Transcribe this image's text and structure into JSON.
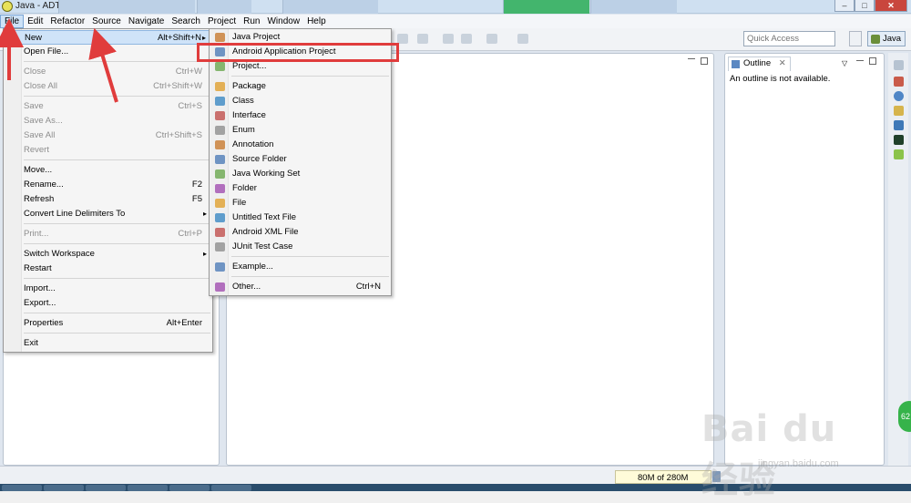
{
  "window": {
    "title": "Java - ADT",
    "controls": [
      "–",
      "□",
      "✕"
    ]
  },
  "menubar": [
    "File",
    "Edit",
    "Refactor",
    "Source",
    "Navigate",
    "Search",
    "Project",
    "Run",
    "Window",
    "Help"
  ],
  "toolbar": {
    "quick_access_placeholder": "Quick Access",
    "perspective_label": "Java"
  },
  "file_menu": [
    {
      "label": "New",
      "shortcut": "Alt+Shift+N",
      "submenu": true,
      "highlighted": true
    },
    {
      "label": "Open File...",
      "shortcut": ""
    },
    {
      "sep": true
    },
    {
      "label": "Close",
      "shortcut": "Ctrl+W",
      "disabled": true
    },
    {
      "label": "Close All",
      "shortcut": "Ctrl+Shift+W",
      "disabled": true
    },
    {
      "sep": true
    },
    {
      "label": "Save",
      "shortcut": "Ctrl+S",
      "disabled": true
    },
    {
      "label": "Save As...",
      "shortcut": "",
      "disabled": true
    },
    {
      "label": "Save All",
      "shortcut": "Ctrl+Shift+S",
      "disabled": true
    },
    {
      "label": "Revert",
      "shortcut": "",
      "disabled": true
    },
    {
      "sep": true
    },
    {
      "label": "Move...",
      "shortcut": ""
    },
    {
      "label": "Rename...",
      "shortcut": "F2"
    },
    {
      "label": "Refresh",
      "shortcut": "F5"
    },
    {
      "label": "Convert Line Delimiters To",
      "shortcut": "",
      "submenu": true
    },
    {
      "sep": true
    },
    {
      "label": "Print...",
      "shortcut": "Ctrl+P",
      "disabled": true
    },
    {
      "sep": true
    },
    {
      "label": "Switch Workspace",
      "shortcut": "",
      "submenu": true
    },
    {
      "label": "Restart",
      "shortcut": ""
    },
    {
      "sep": true
    },
    {
      "label": "Import...",
      "shortcut": ""
    },
    {
      "label": "Export...",
      "shortcut": ""
    },
    {
      "sep": true
    },
    {
      "label": "Properties",
      "shortcut": "Alt+Enter"
    },
    {
      "sep": true
    },
    {
      "label": "Exit",
      "shortcut": ""
    }
  ],
  "new_menu": [
    {
      "label": "Java Project",
      "shortcut": ""
    },
    {
      "label": "Android Application Project",
      "shortcut": "",
      "highlighted": true
    },
    {
      "label": "Project...",
      "shortcut": ""
    },
    {
      "sep": true
    },
    {
      "label": "Package",
      "shortcut": ""
    },
    {
      "label": "Class",
      "shortcut": ""
    },
    {
      "label": "Interface",
      "shortcut": ""
    },
    {
      "label": "Enum",
      "shortcut": ""
    },
    {
      "label": "Annotation",
      "shortcut": ""
    },
    {
      "label": "Source Folder",
      "shortcut": ""
    },
    {
      "label": "Java Working Set",
      "shortcut": ""
    },
    {
      "label": "Folder",
      "shortcut": ""
    },
    {
      "label": "File",
      "shortcut": ""
    },
    {
      "label": "Untitled Text File",
      "shortcut": ""
    },
    {
      "label": "Android XML File",
      "shortcut": ""
    },
    {
      "label": "JUnit Test Case",
      "shortcut": ""
    },
    {
      "sep": true
    },
    {
      "label": "Example...",
      "shortcut": ""
    },
    {
      "sep": true
    },
    {
      "label": "Other...",
      "shortcut": "Ctrl+N"
    }
  ],
  "outline": {
    "tab_label": "Outline",
    "message": "An outline is not available."
  },
  "status": {
    "heap": "80M of 280M"
  },
  "watermark": {
    "text": "Bai du 经验",
    "sub": "jingyan.baidu.com"
  },
  "badge": "62",
  "colors": {
    "highlight_box": "#e03c3c",
    "arrow": "#e03c3c",
    "menu_highlight": "#cfe3f8"
  }
}
